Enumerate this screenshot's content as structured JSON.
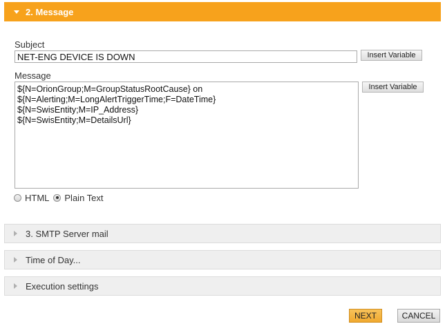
{
  "sections": {
    "message": {
      "title": "2. Message",
      "expanded": true,
      "color": "#f7a21c"
    },
    "smtp": {
      "title": "3. SMTP Server mail",
      "expanded": false
    },
    "time_of_day": {
      "title": "Time of Day...",
      "expanded": false
    },
    "execution": {
      "title": "Execution settings",
      "expanded": false
    }
  },
  "subject": {
    "label": "Subject",
    "value": "NET-ENG DEVICE IS DOWN",
    "insert_label": "Insert Variable"
  },
  "message": {
    "label": "Message",
    "value": "${N=OrionGroup;M=GroupStatusRootCause} on\n${N=Alerting;M=LongAlertTriggerTime;F=DateTime}\n${N=SwisEntity;M=IP_Address}\n${N=SwisEntity;M=DetailsUrl}",
    "insert_label": "Insert Variable"
  },
  "format": {
    "options": [
      {
        "label": "HTML",
        "checked": false
      },
      {
        "label": "Plain Text",
        "checked": true
      }
    ]
  },
  "actions": {
    "next_label": "NEXT",
    "cancel_label": "CANCEL"
  },
  "icons": {
    "expanded": "triangle-down-icon",
    "collapsed": "triangle-right-icon"
  }
}
